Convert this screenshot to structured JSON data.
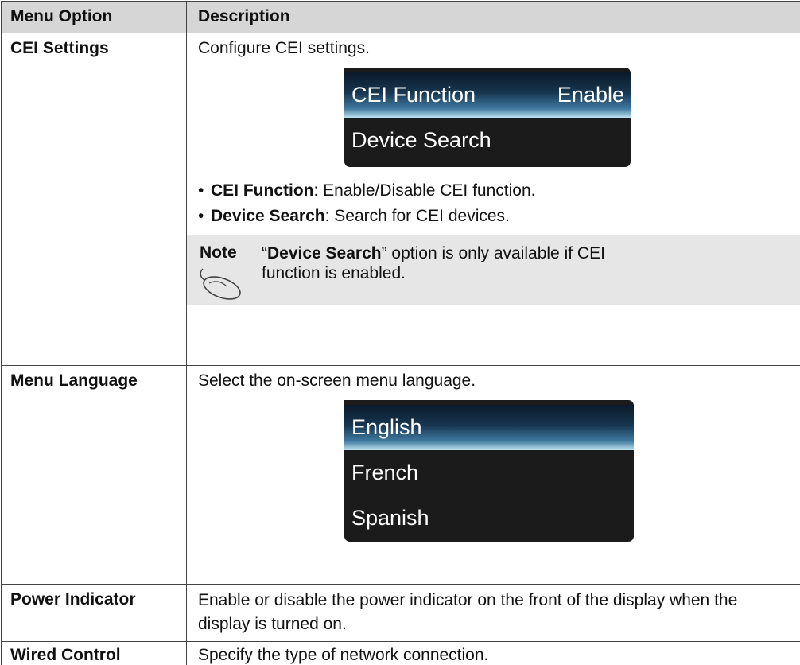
{
  "header": {
    "col1": "Menu Option",
    "col2": "Description"
  },
  "rows": {
    "cei": {
      "option": "CEI Settings",
      "desc": "Configure CEI settings.",
      "osd": {
        "item1_label": "CEI Function",
        "item1_value": "Enable",
        "item2_label": "Device Search"
      },
      "bullet1_bold": "CEI Function",
      "bullet1_rest": ": Enable/Disable CEI function.",
      "bullet2_bold": "Device Search",
      "bullet2_rest": ": Search for CEI devices.",
      "note_label": "Note",
      "note_open_quote": "“",
      "note_bold": "Device Search",
      "note_rest": "” option is only available if CEI function is enabled."
    },
    "language": {
      "option": "Menu Language",
      "desc": "Select the on-screen menu language.",
      "osd_items": [
        "English",
        "French",
        "Spanish"
      ]
    },
    "power": {
      "option": "Power Indicator",
      "desc": "Enable or disable the power indicator on the front of the display when the display is turned on."
    },
    "wired": {
      "option": "Wired Control",
      "desc": "Specify the type of network connection."
    }
  },
  "colors": {
    "header_bg": "#d6d6d6",
    "note_bg": "#e6e6e6",
    "osd_bg": "#1b1b1b",
    "osd_highlight": "#3f7aa0"
  }
}
